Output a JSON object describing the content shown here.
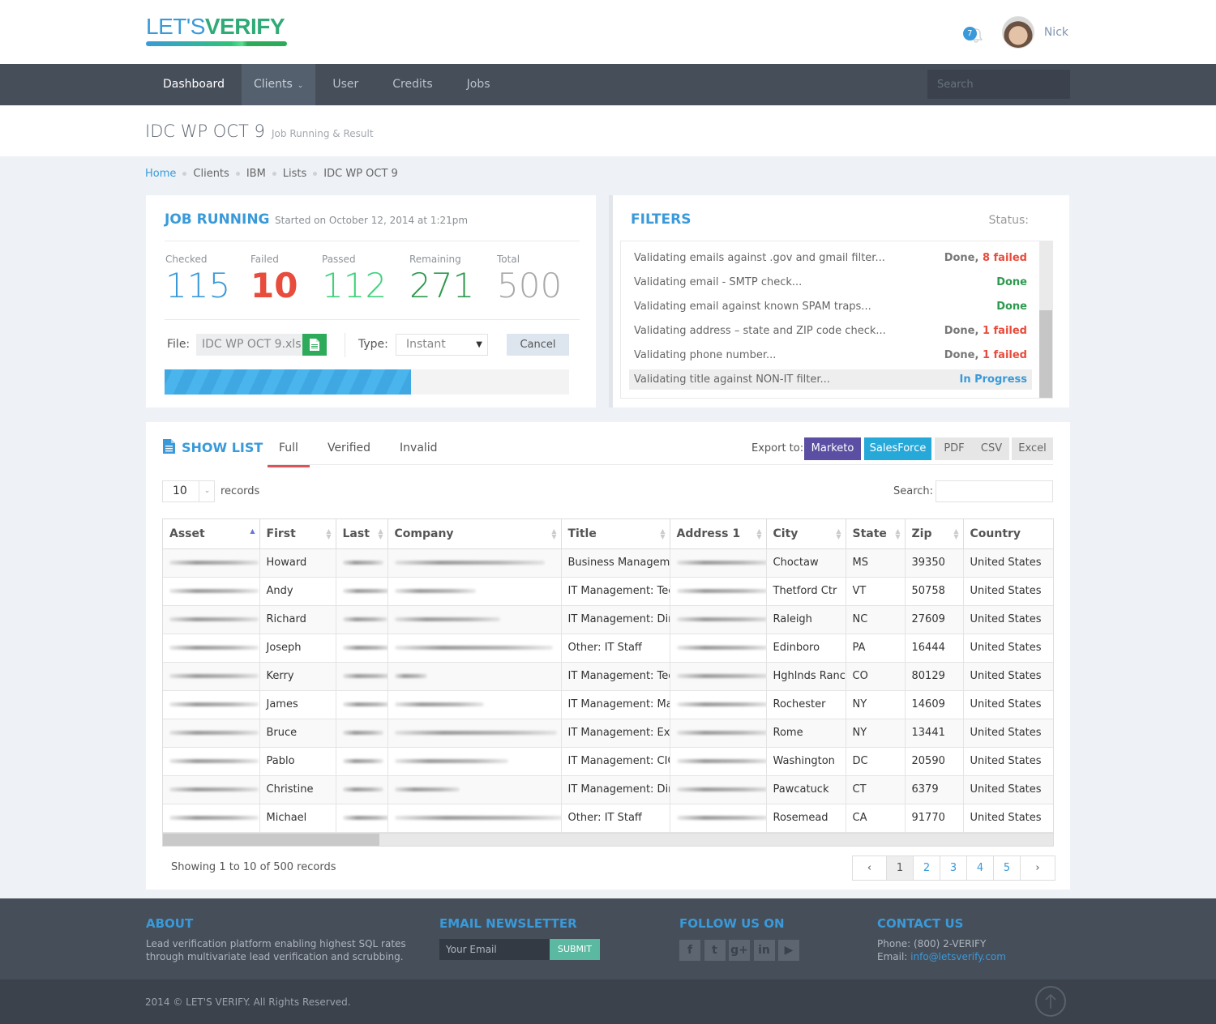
{
  "brand": {
    "light": "LET'S",
    "bold": "VERIFY"
  },
  "header": {
    "notifications": "7",
    "username": "Nick"
  },
  "nav": {
    "items": [
      {
        "label": "Dashboard"
      },
      {
        "label": "Clients"
      },
      {
        "label": "User"
      },
      {
        "label": "Credits"
      },
      {
        "label": "Jobs"
      }
    ],
    "search_placeholder": "Search"
  },
  "page": {
    "title": "IDC WP OCT 9",
    "subtitle": "Job Running & Result"
  },
  "breadcrumb": [
    "Home",
    "Clients",
    "IBM",
    "Lists",
    "IDC WP OCT 9"
  ],
  "job": {
    "title": "JOB RUNNING",
    "started": "Started on October 12, 2014 at 1:21pm",
    "stats": [
      {
        "label": "Checked",
        "value": "115",
        "color": "#3a9ad9"
      },
      {
        "label": "Failed",
        "value": "10",
        "color": "#e74c3c"
      },
      {
        "label": "Passed",
        "value": "112",
        "color": "#3ed27b"
      },
      {
        "label": "Remaining",
        "value": "271",
        "color": "#2e9a4f"
      },
      {
        "label": "Total",
        "value": "500",
        "color": "#a9a9a9"
      }
    ],
    "file_label": "File:",
    "file_name": "IDC WP OCT 9.xls",
    "type_label": "Type:",
    "type_value": "Instant",
    "cancel": "Cancel",
    "progress_percent": 61
  },
  "filters": {
    "title": "FILTERS",
    "status_label": "Status:",
    "items": [
      {
        "text": "Validating emails against .gov and gmail filter...",
        "status": "Done,",
        "failed": "8 failed",
        "kind": "fail"
      },
      {
        "text": "Validating email - SMTP check...",
        "status": "Done",
        "failed": "",
        "kind": "ok"
      },
      {
        "text": "Validating email against known SPAM traps...",
        "status": "Done",
        "failed": "",
        "kind": "ok"
      },
      {
        "text": "Validating address – state and ZIP code check...",
        "status": "Done,",
        "failed": "1 failed",
        "kind": "fail"
      },
      {
        "text": "Validating phone number...",
        "status": "Done,",
        "failed": "1 failed",
        "kind": "fail"
      },
      {
        "text": "Validating title against NON-IT filter...",
        "status": "In Progress",
        "failed": "",
        "kind": "prog"
      }
    ]
  },
  "list": {
    "title": "SHOW LIST",
    "tabs": [
      "Full",
      "Verified",
      "Invalid"
    ],
    "export_label": "Export to:",
    "export_buttons": [
      {
        "label": "Marketo",
        "bg": "#5a4fa3",
        "fg": "#ffffff"
      },
      {
        "label": "SalesForce",
        "bg": "#26a8d8",
        "fg": "#ffffff"
      },
      {
        "label": "PDF",
        "bg": "#e6e6e6",
        "fg": "#666666"
      },
      {
        "label": "CSV",
        "bg": "#e6e6e6",
        "fg": "#666666"
      },
      {
        "label": "Excel",
        "bg": "#e6e6e6",
        "fg": "#666666"
      }
    ],
    "page_length": "10",
    "records_label": "records",
    "search_label": "Search:",
    "columns": [
      "Asset",
      "First",
      "Last",
      "Company",
      "Title",
      "Address 1",
      "City",
      "State",
      "Zip",
      "Country"
    ],
    "rows": [
      {
        "first": "Howard",
        "title": "Business Manageme",
        "city": "Choctaw",
        "state": "MS",
        "zip": "39350",
        "country": "United States"
      },
      {
        "first": "Andy",
        "title": "IT Management: Tecl",
        "city": "Thetford Ctr",
        "state": "VT",
        "zip": "50758",
        "country": "United States"
      },
      {
        "first": "Richard",
        "title": "IT Management: Dire",
        "city": "Raleigh",
        "state": "NC",
        "zip": "27609",
        "country": "United States"
      },
      {
        "first": "Joseph",
        "title": "Other: IT Staff",
        "city": "Edinboro",
        "state": "PA",
        "zip": "16444",
        "country": "United States"
      },
      {
        "first": "Kerry",
        "title": "IT Management: Tecl",
        "city": "Hghlnds Ranc",
        "state": "CO",
        "zip": "80129",
        "country": "United States"
      },
      {
        "first": "James",
        "title": "IT Management: Mar",
        "city": "Rochester",
        "state": "NY",
        "zip": "14609",
        "country": "United States"
      },
      {
        "first": "Bruce",
        "title": "IT Management: Exe",
        "city": "Rome",
        "state": "NY",
        "zip": "13441",
        "country": "United States"
      },
      {
        "first": "Pablo",
        "title": "IT Management: CIO,",
        "city": "Washington",
        "state": "DC",
        "zip": "20590",
        "country": "United States"
      },
      {
        "first": "Christine",
        "title": "IT Management: Dire",
        "city": "Pawcatuck",
        "state": "CT",
        "zip": "6379",
        "country": "United States"
      },
      {
        "first": "Michael",
        "title": "Other: IT Staff",
        "city": "Rosemead",
        "state": "CA",
        "zip": "91770",
        "country": "United States"
      }
    ],
    "showing": "Showing 1 to 10 of 500 records",
    "pages": [
      "‹",
      "1",
      "2",
      "3",
      "4",
      "5",
      "›"
    ],
    "current_page": "1"
  },
  "footer": {
    "about_title": "ABOUT",
    "about_text_1": "Lead verification platform enabling highest SQL rates",
    "about_text_2": "through multivariate lead verification and scrubbing.",
    "newsletter_title": "EMAIL NEWSLETTER",
    "email_placeholder": "Your Email",
    "submit": "SUBMIT",
    "follow_title": "FOLLOW US ON",
    "social": [
      {
        "name": "facebook",
        "glyph": "f"
      },
      {
        "name": "twitter",
        "glyph": "t"
      },
      {
        "name": "google-plus",
        "glyph": "g+"
      },
      {
        "name": "linkedin",
        "glyph": "in"
      },
      {
        "name": "youtube",
        "glyph": "▶"
      }
    ],
    "contact_title": "CONTACT US",
    "phone": "Phone: (800) 2-VERIFY",
    "email_label": "Email:",
    "email": "info@letsverify.com",
    "copyright": "2014 © LET'S VERIFY. All Rights Reserved."
  }
}
